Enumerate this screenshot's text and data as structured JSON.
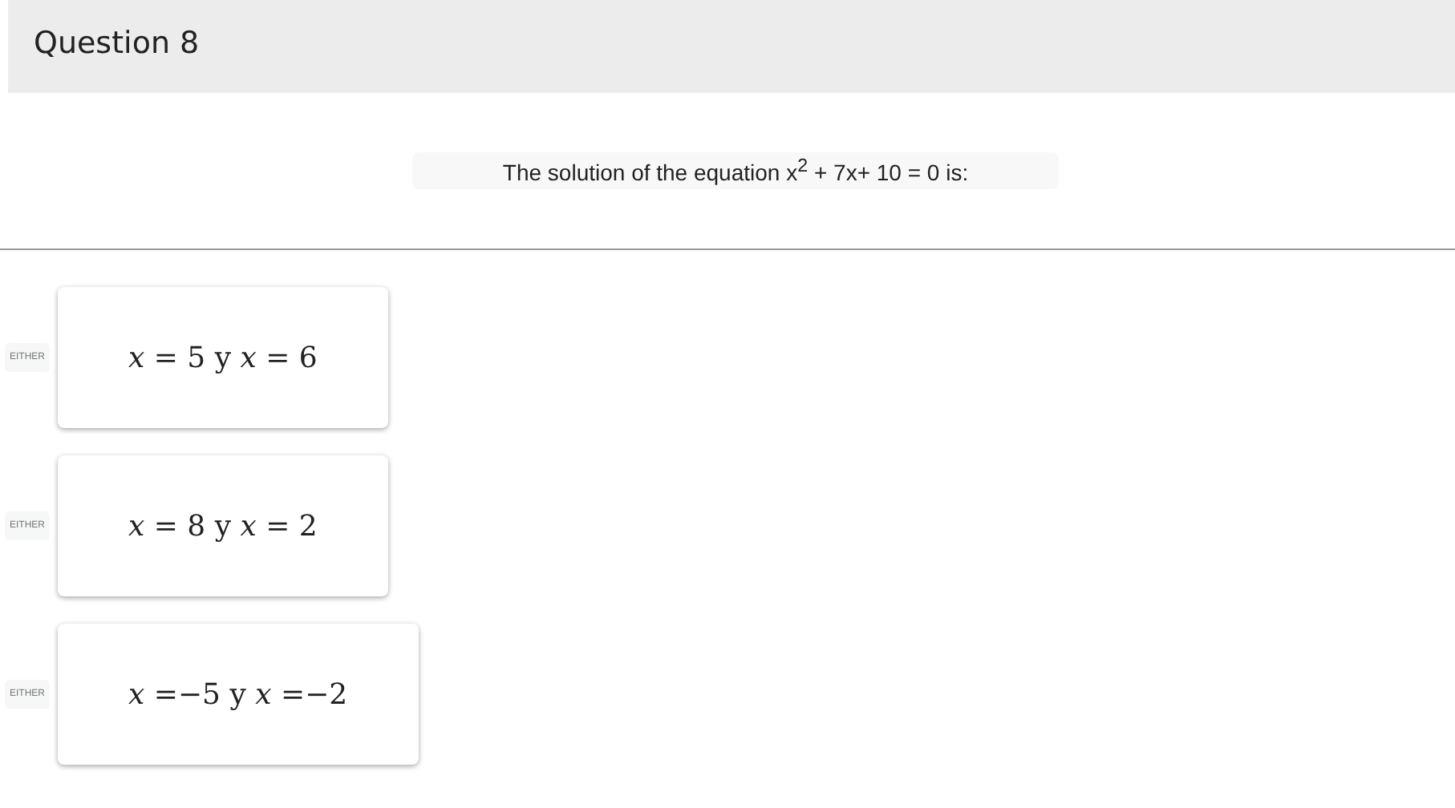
{
  "header": {
    "title": "Question 8"
  },
  "question": {
    "text": "The solution of the equation x$^{2}$ + 7x+ 10 = 0 is:"
  },
  "options": [
    {
      "label": "EITHER",
      "answer": "*x* = 5 y *x* = 6"
    },
    {
      "label": "EITHER",
      "answer": "*x* = 8 y *x* = 2"
    },
    {
      "label": "EITHER",
      "answer": "*x* =−5 y *x* =−2"
    }
  ]
}
